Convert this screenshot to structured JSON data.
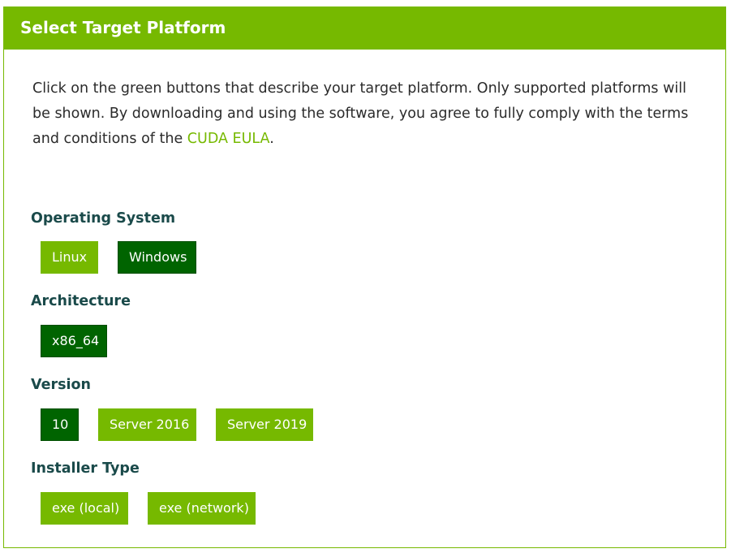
{
  "header": {
    "title": "Select Target Platform"
  },
  "intro": {
    "text_before_link": "Click on the green buttons that describe your target platform. Only supported platforms will be shown. By downloading and using the software, you agree to fully comply with the terms and conditions of the ",
    "link_text": "CUDA EULA",
    "text_after_link": "."
  },
  "sections": {
    "os": {
      "label": "Operating System",
      "options": [
        {
          "label": "Linux",
          "selected": false
        },
        {
          "label": "Windows",
          "selected": true
        }
      ]
    },
    "arch": {
      "label": "Architecture",
      "options": [
        {
          "label": "x86_64",
          "selected": true
        }
      ]
    },
    "version": {
      "label": "Version",
      "options": [
        {
          "label": "10",
          "selected": true
        },
        {
          "label": "Server 2016",
          "selected": false
        },
        {
          "label": "Server 2019",
          "selected": false
        }
      ]
    },
    "installer": {
      "label": "Installer Type",
      "options": [
        {
          "label": "exe (local)",
          "selected": false
        },
        {
          "label": "exe (network)",
          "selected": false
        }
      ]
    }
  },
  "colors": {
    "accent": "#76b900",
    "selected": "#006400",
    "label_text": "#1a4a4a",
    "body_text": "#2b2b2b"
  }
}
